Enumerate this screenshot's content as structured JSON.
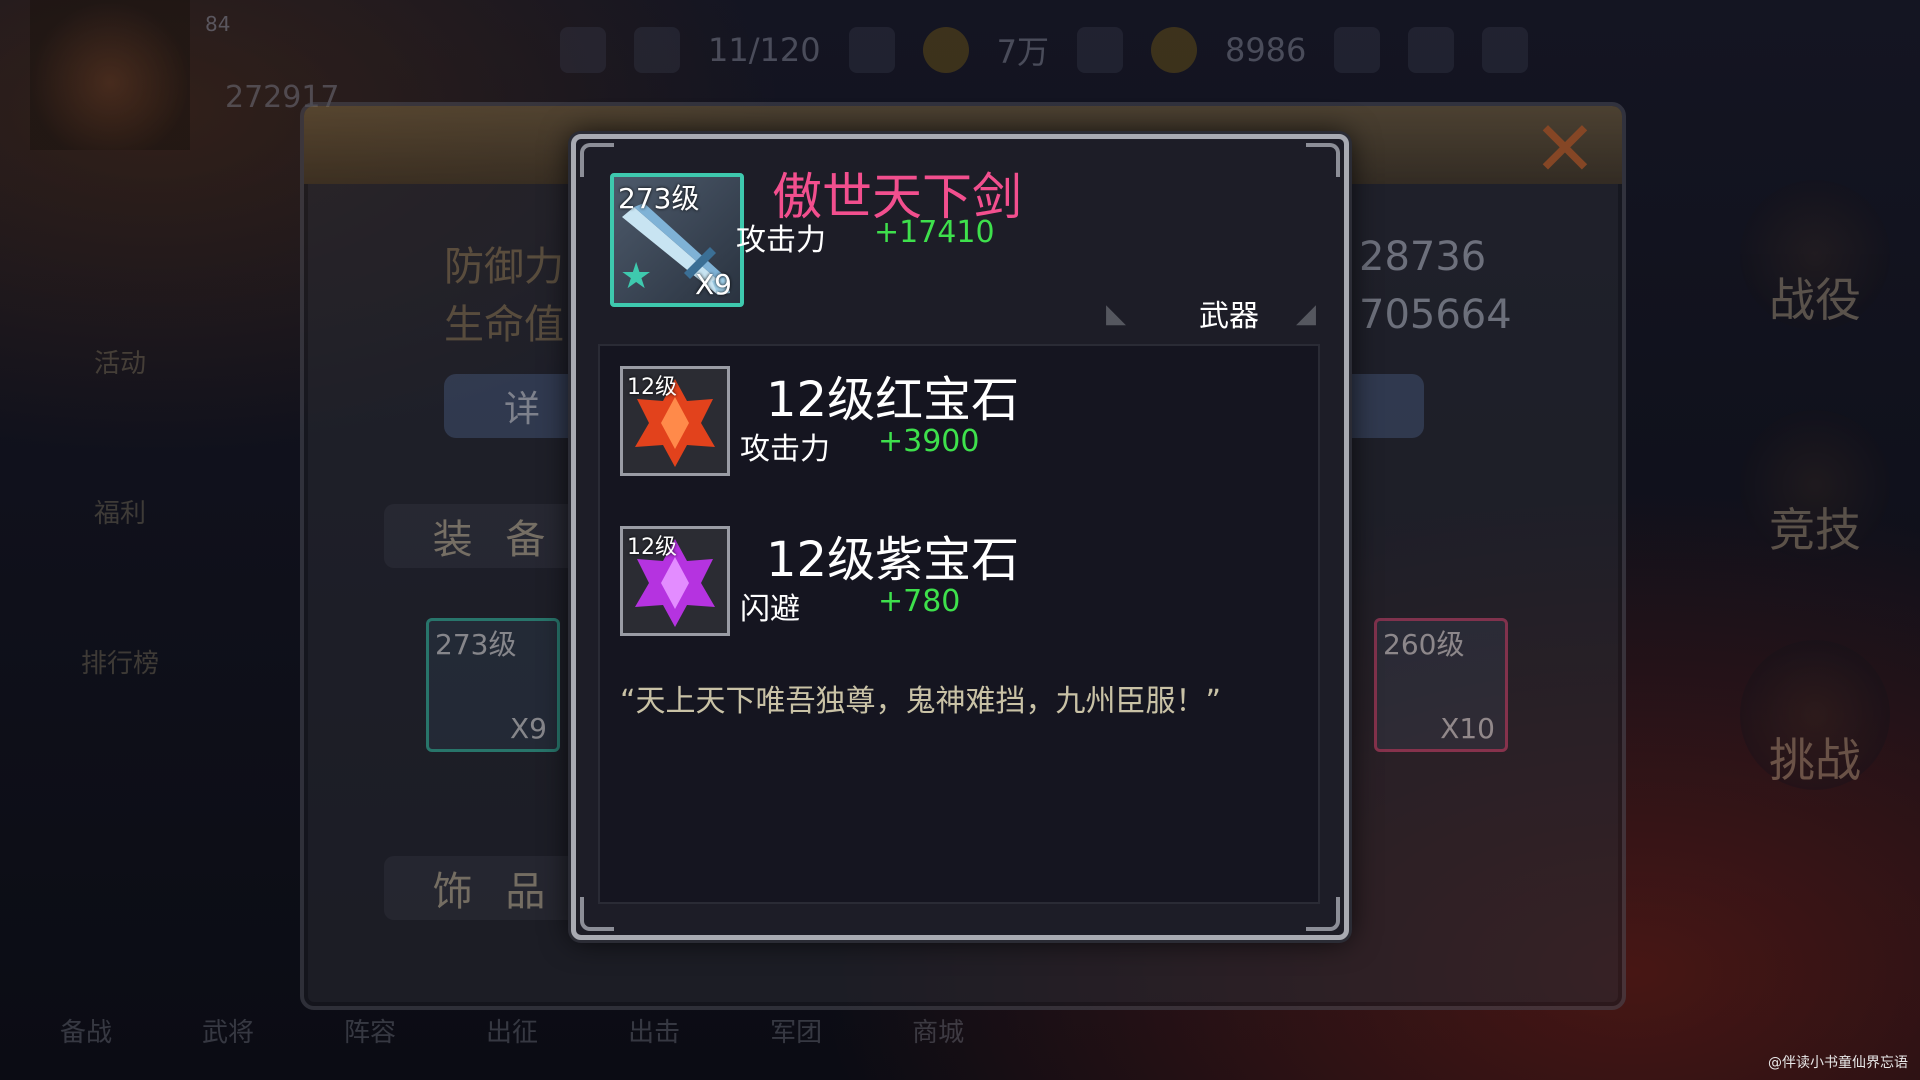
{
  "background": {
    "hero_name": "84",
    "hero_power": "272917",
    "topbar": {
      "stamina": "11/120",
      "coins": "7万",
      "gems": "8986"
    },
    "left_menu": [
      "活动",
      "福利",
      "排行榜",
      "",
      "",
      "备战"
    ],
    "right_menu": [
      "战役",
      "竞技",
      "挑战"
    ],
    "bottom_nav": [
      "备战",
      "武将",
      "阵容",
      "出征",
      "出击",
      "军团",
      "商城"
    ]
  },
  "hero_panel": {
    "stats": [
      {
        "label": "防御力：",
        "value": "28736"
      },
      {
        "label": "生命值：",
        "value": "705664"
      }
    ],
    "detail_button": "详",
    "tabs": {
      "equipment": "装 备",
      "accessory": "饰 品"
    },
    "equip_left": {
      "level": "273级",
      "count": "X9"
    },
    "equip_right": {
      "level": "260级",
      "count": "X10"
    }
  },
  "tooltip": {
    "item": {
      "name": "傲世天下剑",
      "level": "273级",
      "count": "X9",
      "attr_label": "攻击力",
      "attr_value": "+17410",
      "type": "武器"
    },
    "gems": [
      {
        "level": "12级",
        "name": "12级红宝石",
        "attr_label": "攻击力",
        "attr_value": "+3900",
        "color": "#e2421c"
      },
      {
        "level": "12级",
        "name": "12级紫宝石",
        "attr_label": "闪避",
        "attr_value": "+780",
        "color": "#b533e0"
      }
    ],
    "quote": "“天上天下唯吾独尊，鬼神难挡，九州臣服！”"
  },
  "colors": {
    "item_name": "#f24f8e",
    "attr_value": "#3ee04c",
    "rarity_border": "#3ec9ae",
    "close_x": "#e2702a"
  },
  "watermark": "@伴读小书童仙界忘语"
}
